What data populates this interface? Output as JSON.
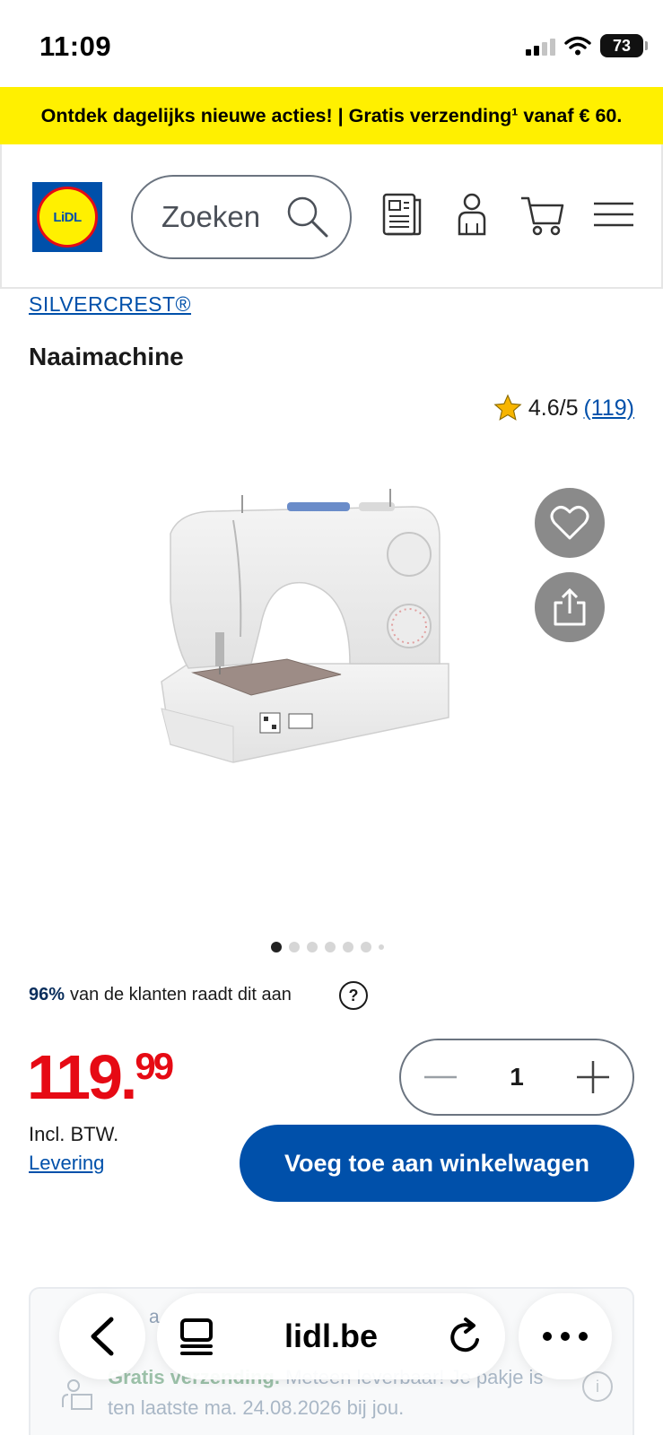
{
  "status_bar": {
    "time": "11:09",
    "battery": "73"
  },
  "promo": {
    "text": "Ontdek dagelijks nieuwe acties! | Gratis verzending¹ vanaf € 60."
  },
  "header": {
    "logo_text": "LiDL",
    "search_placeholder": "Zoeken"
  },
  "product": {
    "brand": "SILVERCREST®",
    "title": "Naaimachine",
    "rating": "4.6/5",
    "review_count": "(119)",
    "image_count": 7,
    "active_image": 1,
    "recommend_percent": "96%",
    "recommend_text": "van de klanten raadt dit aan",
    "help": "?",
    "price_int": "119.",
    "price_dec": "99",
    "vat": "Incl. BTW.",
    "delivery_link": "Levering",
    "quantity": "1",
    "add_to_cart": "Voeg toe aan winkelwagen"
  },
  "delivery_card": {
    "label": "a",
    "text_bold": "Gratis verzending.",
    "text": " Meteen leverbaar! Je pakje is ten laatste ma. 24.08.2026 bij jou.",
    "info": "i"
  },
  "browser": {
    "url": "lidl.be"
  },
  "colors": {
    "brand_blue": "#0050aa",
    "price_red": "#e60a14",
    "promo_yellow": "#fff000"
  }
}
